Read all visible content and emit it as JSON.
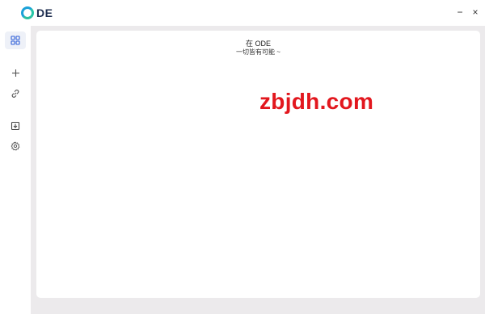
{
  "app": {
    "logo_text": "DE",
    "accent": "#1ba1d8",
    "window_controls": {
      "minimize": "−",
      "close": "×"
    }
  },
  "sidebar": {
    "items": [
      {
        "name": "dashboard",
        "icon": "grid-icon",
        "active": true
      },
      {
        "name": "add",
        "icon": "plus-icon",
        "active": false
      },
      {
        "name": "link",
        "icon": "link-icon",
        "active": false
      },
      {
        "name": "download",
        "icon": "download-icon",
        "active": false
      },
      {
        "name": "settings",
        "icon": "gear-icon",
        "active": false
      }
    ]
  },
  "main": {
    "title": "在 ODE",
    "subtitle": "一切皆有可能 ~"
  },
  "watermark": {
    "text": "zbjdh.com",
    "color": "#e2171e"
  }
}
